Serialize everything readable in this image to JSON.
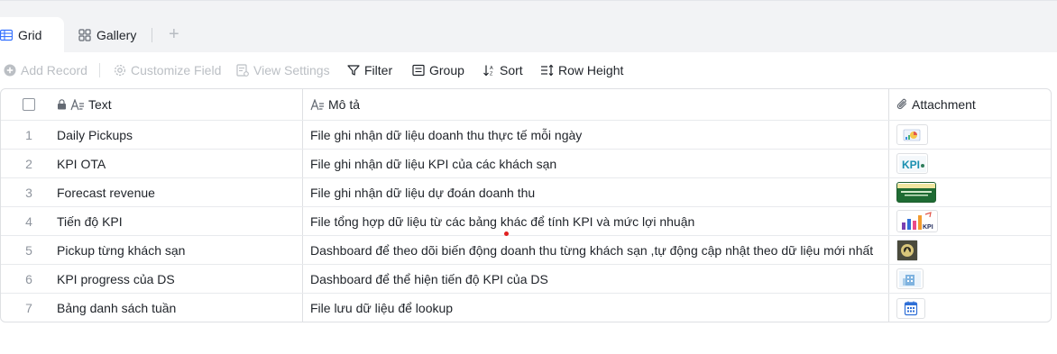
{
  "tabs": {
    "grid": "Grid",
    "gallery": "Gallery",
    "add": "+"
  },
  "toolbar": {
    "add_record": "Add Record",
    "customize_field": "Customize Field",
    "view_settings": "View Settings",
    "filter": "Filter",
    "group": "Group",
    "sort": "Sort",
    "row_height": "Row Height"
  },
  "columns": {
    "text": "Text",
    "desc": "Mô tả",
    "attachment": "Attachment"
  },
  "rows": [
    {
      "idx": "1",
      "text": "Daily Pickups",
      "desc": "File ghi nhận dữ liệu doanh thu thực tế mỗi ngày",
      "thumb": "chart-pie-thumb"
    },
    {
      "idx": "2",
      "text": "KPI OTA",
      "desc": "File ghi nhận dữ liệu KPI của các khách sạn",
      "thumb": "kpi-text-thumb"
    },
    {
      "idx": "3",
      "text": "Forecast revenue",
      "desc": "File ghi nhận dữ liệu dự đoán doanh thu",
      "thumb": "forecast-banner-thumb"
    },
    {
      "idx": "4",
      "text": "Tiến độ KPI",
      "desc": "File tổng hợp dữ liệu từ các bảng khác để tính KPI và mức lợi nhuận",
      "thumb": "kpi-bars-thumb"
    },
    {
      "idx": "5",
      "text": "Pickup từng khách sạn",
      "desc": "Dashboard để theo dõi biến động doanh thu từng khách sạn ,tự động cập nhật theo dữ liệu mới nhất",
      "thumb": "hotel-logo-thumb"
    },
    {
      "idx": "6",
      "text": "KPI progress của DS",
      "desc": "Dashboard để thể hiện tiến độ KPI của DS",
      "thumb": "building-thumb"
    },
    {
      "idx": "7",
      "text": "Bảng danh sách tuần",
      "desc": "File lưu dữ liệu để lookup",
      "thumb": "calendar-thumb"
    }
  ],
  "colors": {
    "accent": "#3370ff",
    "border": "#dee0e3",
    "disabled": "#bbbfc4"
  }
}
